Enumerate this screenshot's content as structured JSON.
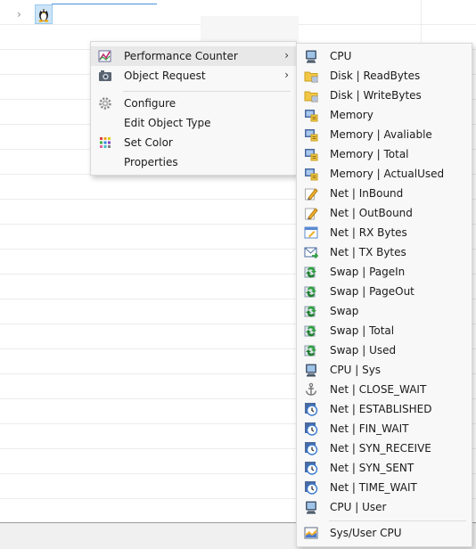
{
  "tree": {
    "expand_glyph": "›",
    "node_icon": "linux-penguin-icon"
  },
  "context_menu": {
    "items": [
      {
        "label": "Performance Counter",
        "icon": "chart-icon",
        "has_submenu": true,
        "highlighted": true
      },
      {
        "label": "Object Request",
        "icon": "camera-icon",
        "has_submenu": true
      },
      {
        "label": "Configure",
        "icon": "gear-icon"
      },
      {
        "label": "Edit Object Type",
        "icon": ""
      },
      {
        "label": "Set Color",
        "icon": "color-grid-icon"
      },
      {
        "label": "Properties",
        "icon": ""
      }
    ],
    "submenu_arrow": "›"
  },
  "submenu": {
    "items": [
      {
        "label": "CPU",
        "icon": "monitor-icon"
      },
      {
        "label": "Disk | ReadBytes",
        "icon": "folder-icon"
      },
      {
        "label": "Disk | WriteBytes",
        "icon": "folder-icon"
      },
      {
        "label": "Memory",
        "icon": "memory-icon"
      },
      {
        "label": "Memory | Avaliable",
        "icon": "memory-icon"
      },
      {
        "label": "Memory | Total",
        "icon": "memory-icon"
      },
      {
        "label": "Memory | ActualUsed",
        "icon": "memory-icon"
      },
      {
        "label": "Net | InBound",
        "icon": "pencil-icon"
      },
      {
        "label": "Net | OutBound",
        "icon": "pencil-icon"
      },
      {
        "label": "Net | RX Bytes",
        "icon": "edit-window-icon"
      },
      {
        "label": "Net | TX Bytes",
        "icon": "mail-icon"
      },
      {
        "label": "Swap | PageIn",
        "icon": "swap-icon"
      },
      {
        "label": "Swap | PageOut",
        "icon": "swap-icon"
      },
      {
        "label": "Swap",
        "icon": "swap-icon"
      },
      {
        "label": "Swap | Total",
        "icon": "swap-icon"
      },
      {
        "label": "Swap | Used",
        "icon": "swap-icon"
      },
      {
        "label": "CPU | Sys",
        "icon": "monitor-icon"
      },
      {
        "label": "Net | CLOSE_WAIT",
        "icon": "anchor-icon"
      },
      {
        "label": "Net | ESTABLISHED",
        "icon": "clock-icon"
      },
      {
        "label": "Net | FIN_WAIT",
        "icon": "clock-icon"
      },
      {
        "label": "Net | SYN_RECEIVE",
        "icon": "clock-icon"
      },
      {
        "label": "Net | SYN_SENT",
        "icon": "clock-icon"
      },
      {
        "label": "Net | TIME_WAIT",
        "icon": "clock-icon"
      },
      {
        "label": "CPU | User",
        "icon": "monitor-icon"
      }
    ],
    "footer_item": {
      "label": "Sys/User CPU",
      "icon": "area-chart-icon"
    }
  },
  "colors": {
    "menu_bg": "#f8f8f8",
    "highlight": "#e8e8e8",
    "selection": "#cce4f7"
  }
}
